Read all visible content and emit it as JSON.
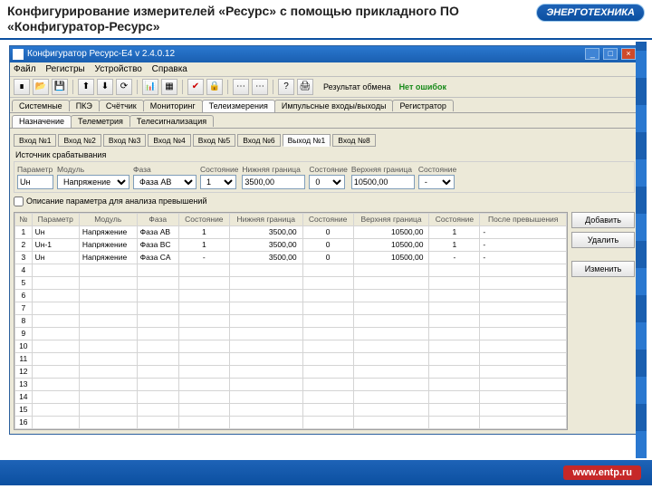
{
  "slide": {
    "title": "Конфигурирование измерителей «Ресурс» с помощью прикладного ПО «Конфигуратор-Ресурс»",
    "logo": "ЭНЕРГОТЕХНИКА",
    "footer_url": "www.entp.ru"
  },
  "window": {
    "title": "Конфигуратор Ресурс-E4  v 2.4.0.12",
    "menu": [
      "Файл",
      "Регистры",
      "Устройство",
      "Справка"
    ],
    "status1_label": "Результат обмена",
    "status1_value": "Нет ошибок",
    "tabs1": [
      "Системные",
      "ПКЭ",
      "Счётчик",
      "Мониторинг",
      "Телеизмерения",
      "Импульсные входы/выходы",
      "Регистратор"
    ],
    "tabs1_active": 4,
    "tabs2": [
      "Назначение",
      "Телеметрия",
      "Телесигнализация"
    ],
    "tabs2_active": 0,
    "vh_tabs": [
      "Вход №1",
      "Вход №2",
      "Вход №3",
      "Вход №4",
      "Вход №5",
      "Вход №6",
      "Выход №1",
      "Вход №8"
    ],
    "vh_active": 6,
    "section_title": "Источник срабатывания",
    "fields": {
      "param_label": "Параметр",
      "param_value": "Uн",
      "module_label": "Модуль",
      "module_value": "Напряжение",
      "phase_label": "Фаза",
      "phase_value": "Фаза AB",
      "sost1_label": "Состояние",
      "sost1_value": "1",
      "low_label": "Нижняя граница",
      "low_value": "3500,00",
      "sost2_label": "Состояние",
      "sost2_value": "0",
      "high_label": "Верхняя граница",
      "high_value": "10500,00",
      "sost3_label": "Состояние",
      "sost3_value": "-"
    },
    "checkbox_label": "Описание параметра для анализа превышений",
    "grid_columns": [
      "№",
      "Параметр",
      "Модуль",
      "Фаза",
      "Состояние",
      "Нижняя граница",
      "Состояние",
      "Верхняя граница",
      "Состояние",
      "После превышения"
    ],
    "grid_rows": [
      {
        "n": "1",
        "p": "Uн",
        "m": "Напряжение",
        "f": "Фаза AB",
        "s1": "1",
        "low": "3500,00",
        "s2": "0",
        "high": "10500,00",
        "s3": "1",
        "after": "-"
      },
      {
        "n": "2",
        "p": "Uн-1",
        "m": "Напряжение",
        "f": "Фаза BC",
        "s1": "1",
        "low": "3500,00",
        "s2": "0",
        "high": "10500,00",
        "s3": "1",
        "after": "-"
      },
      {
        "n": "3",
        "p": "Uн",
        "m": "Напряжение",
        "f": "Фаза CA",
        "s1": "-",
        "low": "3500,00",
        "s2": "0",
        "high": "10500,00",
        "s3": "-",
        "after": "-"
      }
    ],
    "empty_rows": [
      "4",
      "5",
      "6",
      "7",
      "8",
      "9",
      "10",
      "11",
      "12",
      "13",
      "14",
      "15",
      "16"
    ],
    "buttons": {
      "add": "Добавить",
      "del": "Удалить",
      "edit": "Изменить"
    }
  }
}
